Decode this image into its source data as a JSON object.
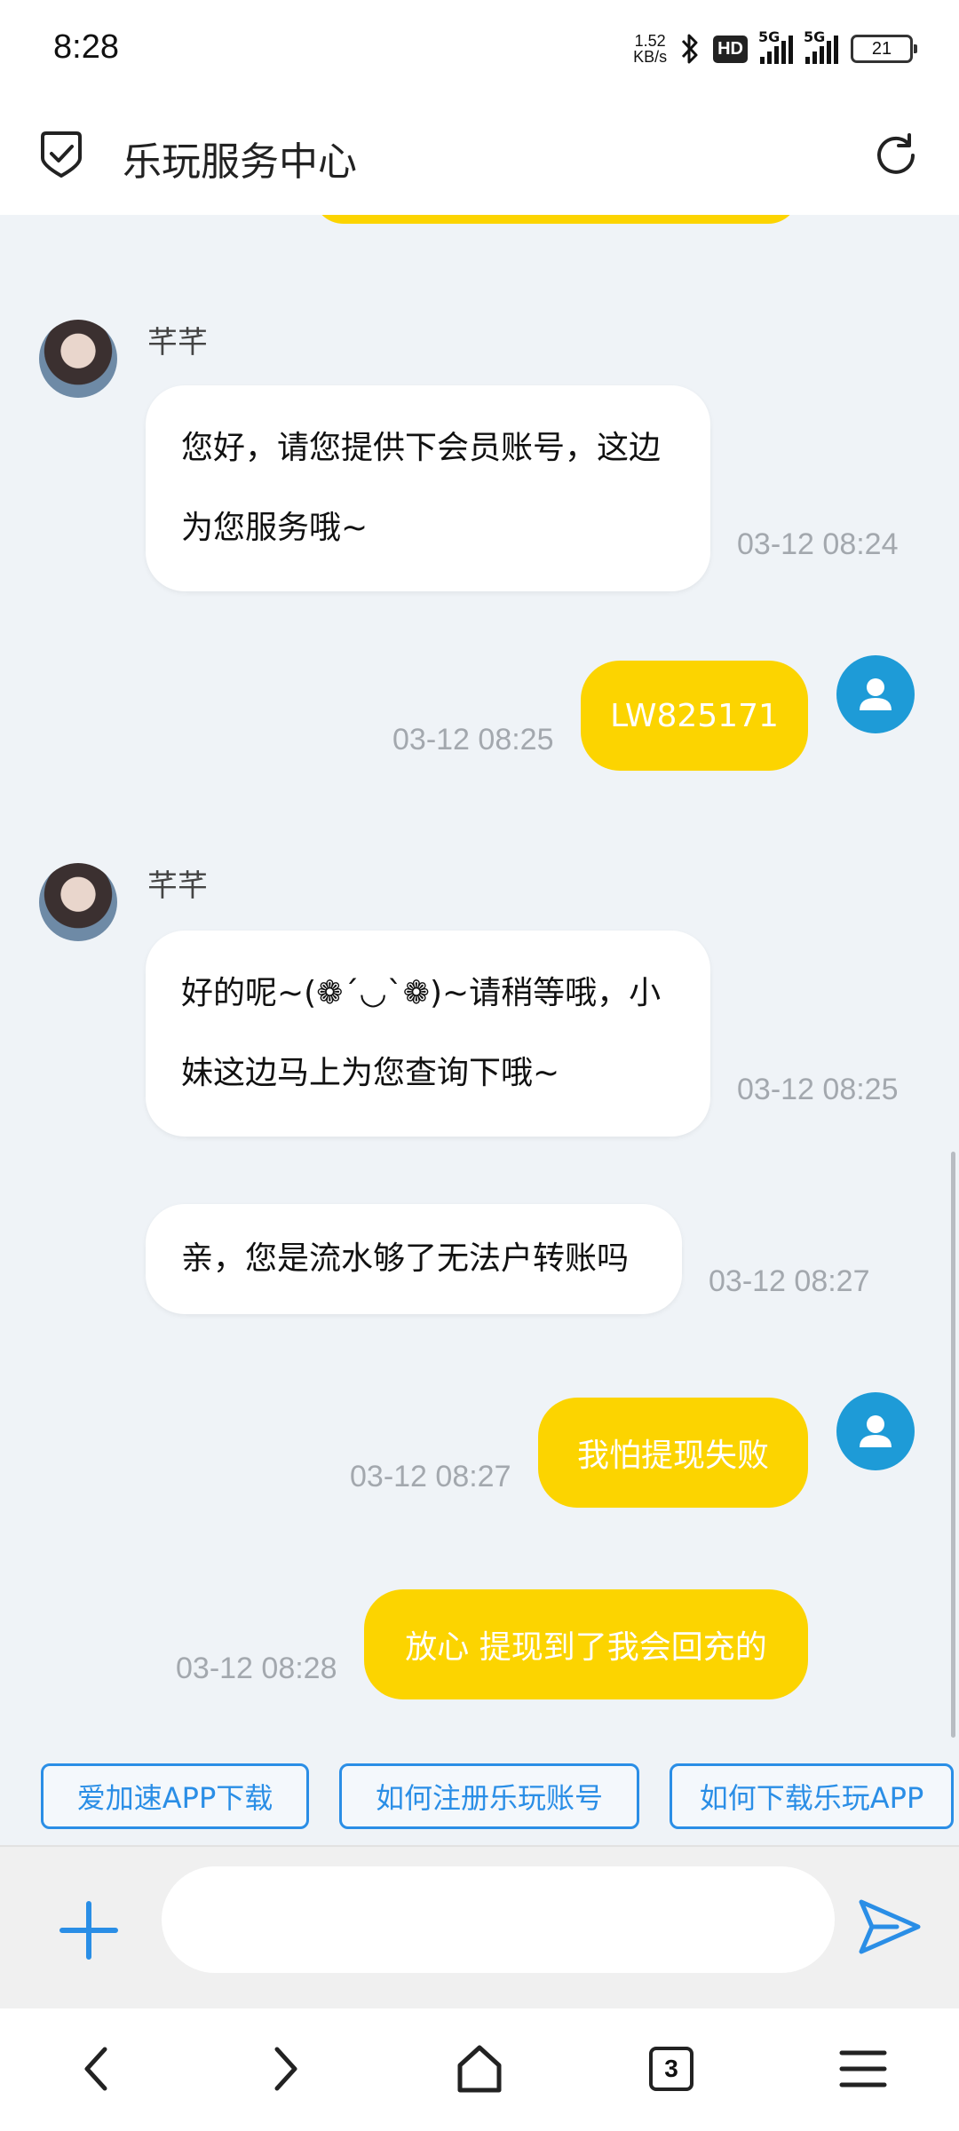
{
  "status_bar": {
    "time": "8:28",
    "net_speed_value": "1.52",
    "net_speed_unit": "KB/s",
    "hd_badge": "HD",
    "sim1_label": "5G",
    "sim2_label": "5G",
    "battery": "21",
    "icons": [
      "bluetooth-icon",
      "signal-icon",
      "battery-icon"
    ]
  },
  "header": {
    "title": "乐玩服务中心",
    "icons": [
      "shield-check-icon",
      "refresh-icon"
    ]
  },
  "messages": [
    {
      "side": "in",
      "sender": "芊芊",
      "text": "您好，请您提供下会员账号，这边为您服务哦~",
      "time": "03-12 08:24"
    },
    {
      "side": "out",
      "text": "LW825171",
      "time": "03-12 08:25"
    },
    {
      "side": "in",
      "sender": "芊芊",
      "text": "好的呢~(❁´◡`❁)~请稍等哦，小妹这边马上为您查询下哦~",
      "time": "03-12 08:25"
    },
    {
      "side": "in",
      "text": "亲，您是流水够了无法户转账吗",
      "time": "03-12 08:27"
    },
    {
      "side": "out",
      "text": "我怕提现失败",
      "time": "03-12 08:27"
    },
    {
      "side": "out",
      "text": "放心 提现到了我会回充的",
      "time": "03-12 08:28"
    }
  ],
  "quick_replies": [
    "爱加速APP下载",
    "如何注册乐玩账号",
    "如何下载乐玩APP"
  ],
  "input": {
    "value": "",
    "placeholder": ""
  },
  "browser_nav": {
    "tab_count": "3"
  },
  "colors": {
    "accent_yellow": "#fcd400",
    "link_blue": "#2a8ee6",
    "chat_bg": "#eff3f7",
    "user_avatar": "#1e9bd7"
  }
}
